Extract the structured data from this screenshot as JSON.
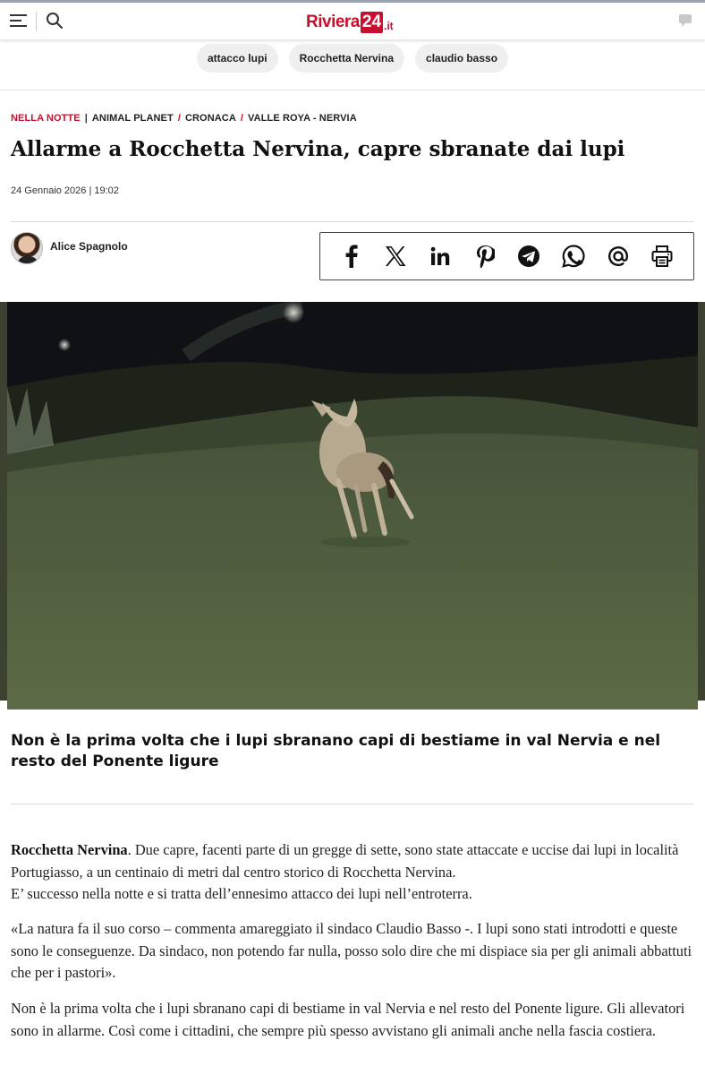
{
  "header": {
    "logo": {
      "word": "Riviera",
      "number": "24",
      "tld": ".it"
    },
    "brand_color": "#c8102e",
    "icons": [
      "menu-icon",
      "search-icon",
      "comment-icon"
    ]
  },
  "tags": [
    "attacco lupi",
    "Rocchetta Nervina",
    "claudio basso"
  ],
  "breadcrumb": {
    "highlight": "NELLA NOTTE",
    "items": [
      "ANIMAL PLANET",
      "CRONACA",
      "VALLE ROYA - NERVIA"
    ]
  },
  "article": {
    "title": "Allarme a Rocchetta Nervina, capre sbranate dai lupi",
    "date": "24 Gennaio 2026 | 19:02",
    "author": "Alice Spagnolo",
    "share_icons": [
      "facebook-icon",
      "x-icon",
      "linkedin-icon",
      "pinterest-icon",
      "telegram-icon",
      "whatsapp-icon",
      "email-icon",
      "print-icon"
    ],
    "subtitle": "Non è la prima volta che i lupi sbranano capi di bestiame in val Nervia e nel resto del Ponente ligure",
    "lead_strong": "Rocchetta Nervina",
    "p1_rest": ". Due capre, facenti parte di un gregge di sette, sono state attaccate e uccise dai lupi in località Portugiasso, a un centinaio di metri dal centro storico di Rocchetta Nervina.",
    "p1_line2": "E’ successo nella notte e si tratta dell’ennesimo attacco dei lupi nell’entroterra.",
    "p2": "«La natura fa il suo corso – commenta amareggiato il sindaco Claudio Basso -. I lupi sono stati introdotti e queste sono le conseguenze. Da sindaco, non potendo far nulla, posso solo dire che mi dispiace sia per gli animali abbattuti che per i pastori».",
    "p3": "Non è la prima volta che i lupi sbranano capi di bestiame in val Nervia e nel resto del Ponente ligure. Gli allevatori sono in allarme. Così come i cittadini, che sempre più spesso avvistano gli animali anche nella fascia costiera."
  }
}
